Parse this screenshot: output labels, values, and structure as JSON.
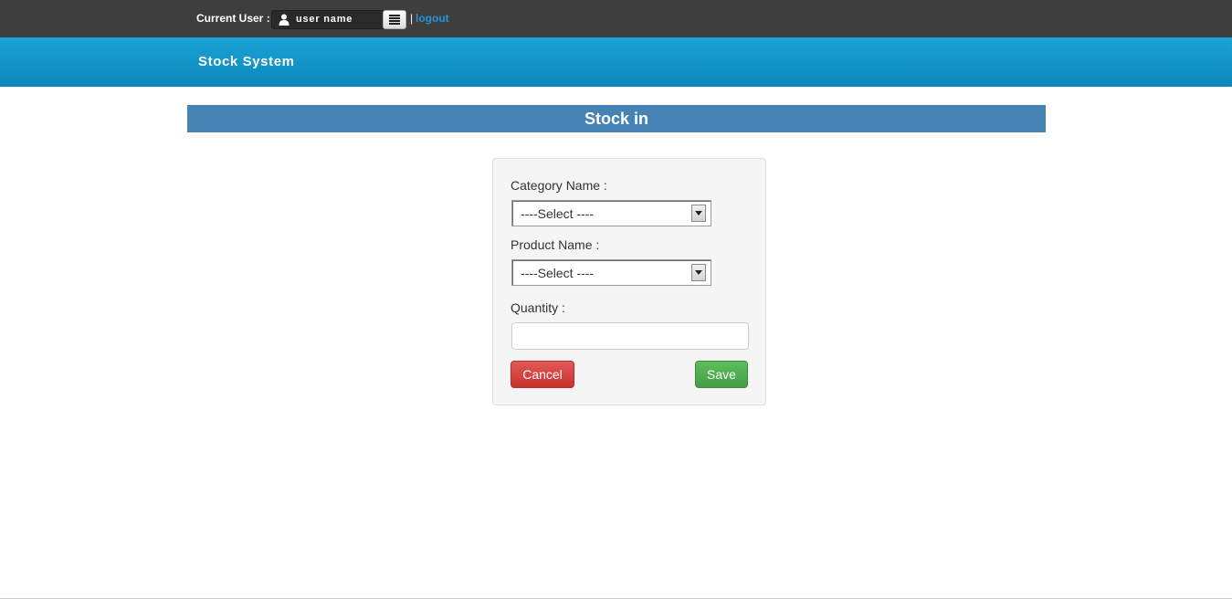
{
  "topbar": {
    "current_user_label": "Current User :",
    "user_name": "user name",
    "separator": "|",
    "logout_label": "logout"
  },
  "header": {
    "brand": "Stock System"
  },
  "page": {
    "title": "Stock in"
  },
  "form": {
    "category_label": "Category Name :",
    "category_value": "----Select ----",
    "product_label": "Product Name :",
    "product_value": "----Select ----",
    "quantity_label": "Quantity :",
    "quantity_value": "",
    "cancel_label": "Cancel",
    "save_label": "Save"
  },
  "colors": {
    "topbar": "#3e3e3e",
    "header": "#1197c8",
    "title_strip": "#4682b4",
    "cancel": "#d9534f",
    "save": "#5cb85c",
    "link": "#2a8fd8"
  },
  "icons": {
    "user": "user-icon",
    "menu": "menu-icon",
    "dropdown": "chevron-down-icon"
  }
}
